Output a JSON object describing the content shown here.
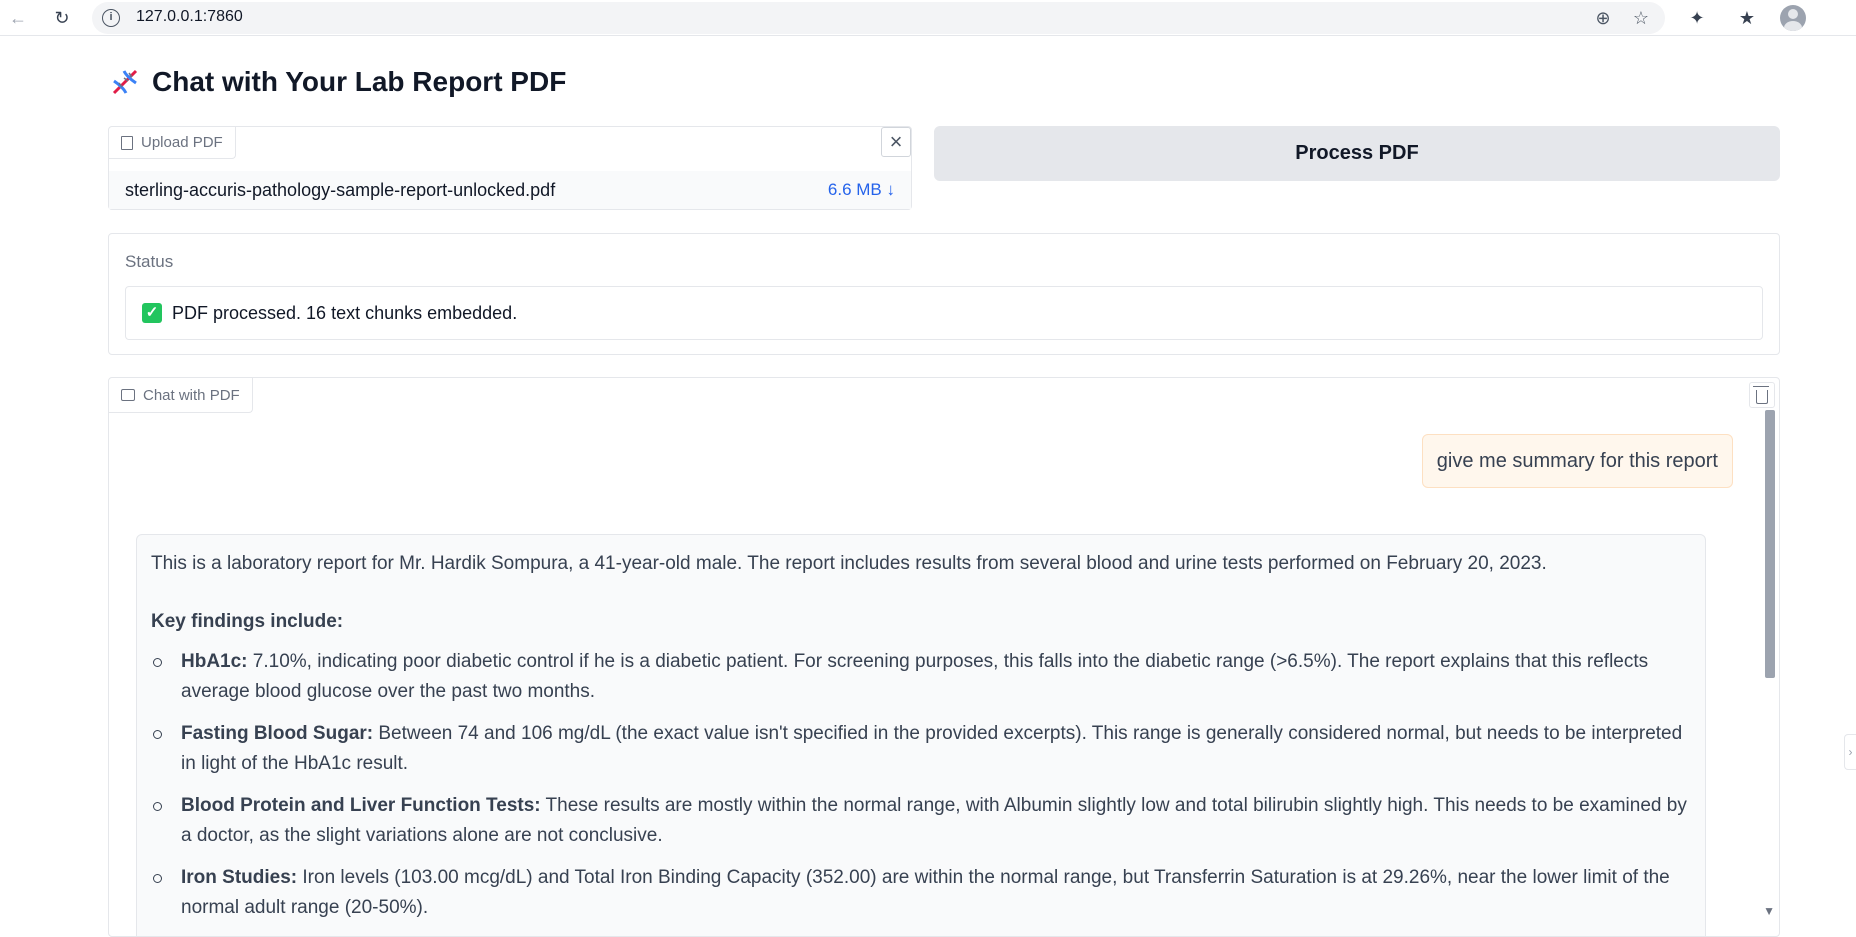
{
  "browser": {
    "url": "127.0.0.1:7860",
    "back_icon": "arrow-left-icon",
    "reload_icon": "reload-icon",
    "zoom_icon": "zoom-icon",
    "star_icon": "star-icon",
    "extensions_icon": "puzzle-icon",
    "favorites_icon": "favorites-icon",
    "profile_icon": "avatar-icon"
  },
  "page": {
    "title": "Chat with Your Lab Report PDF",
    "title_icon": "dna-icon"
  },
  "upload": {
    "label": "Upload PDF",
    "file_name": "sterling-accuris-pathology-sample-report-unlocked.pdf",
    "file_size": "6.6 MB ↓"
  },
  "process_button": {
    "label": "Process PDF"
  },
  "status": {
    "label": "Status",
    "text": "PDF processed. 16 text chunks embedded."
  },
  "chat": {
    "label": "Chat with PDF",
    "user_message": "give me summary for this report",
    "bot_intro": "This is a laboratory report for Mr. Hardik Sompura, a 41-year-old male. The report includes results from several blood and urine tests performed on February 20, 2023.",
    "bot_heading": "Key findings include:",
    "findings": [
      {
        "key": "HbA1c:",
        "text": " 7.10%, indicating poor diabetic control if he is a diabetic patient. For screening purposes, this falls into the diabetic range (>6.5%). The report explains that this reflects average blood glucose over the past two months."
      },
      {
        "key": "Fasting Blood Sugar:",
        "text": " Between 74 and 106 mg/dL (the exact value isn't specified in the provided excerpts). This range is generally considered normal, but needs to be interpreted in light of the HbA1c result."
      },
      {
        "key": "Blood Protein and Liver Function Tests:",
        "text": " These results are mostly within the normal range, with Albumin slightly low and total bilirubin slightly high. This needs to be examined by a doctor, as the slight variations alone are not conclusive."
      },
      {
        "key": "Iron Studies:",
        "text": " Iron levels (103.00 mcg/dL) and Total Iron Binding Capacity (352.00) are within the normal range, but Transferrin Saturation is at 29.26%, near the lower limit of the normal adult range (20-50%)."
      }
    ]
  }
}
